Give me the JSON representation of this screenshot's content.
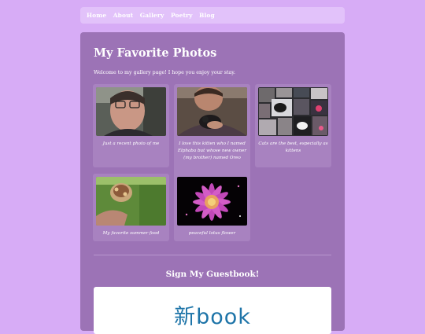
{
  "nav": {
    "items": [
      {
        "label": "Home"
      },
      {
        "label": "About"
      },
      {
        "label": "Gallery"
      },
      {
        "label": "Poetry"
      },
      {
        "label": "Blog"
      }
    ]
  },
  "gallery": {
    "title": "My Favorite Photos",
    "intro": "Welcome to my gallery page! I hope you enjoy your stay.",
    "photos": [
      {
        "caption": "Just a recent photo of me"
      },
      {
        "caption": "I love this kitten who I named Elphaba but whose new owner (my brother) named Oreo"
      },
      {
        "caption": "Cats are the best, especially as kittens"
      },
      {
        "caption": "My favorite summer food"
      },
      {
        "caption": "peaceful lotus flower"
      }
    ]
  },
  "guestbook": {
    "title": "Sign My Guestbook!",
    "logo_text": "新book"
  },
  "colors": {
    "page_bg": "#d7acf6",
    "panel_bg": "#9c73b6",
    "card_bg": "#a882c0",
    "logo_blue": "#1d74a8"
  }
}
